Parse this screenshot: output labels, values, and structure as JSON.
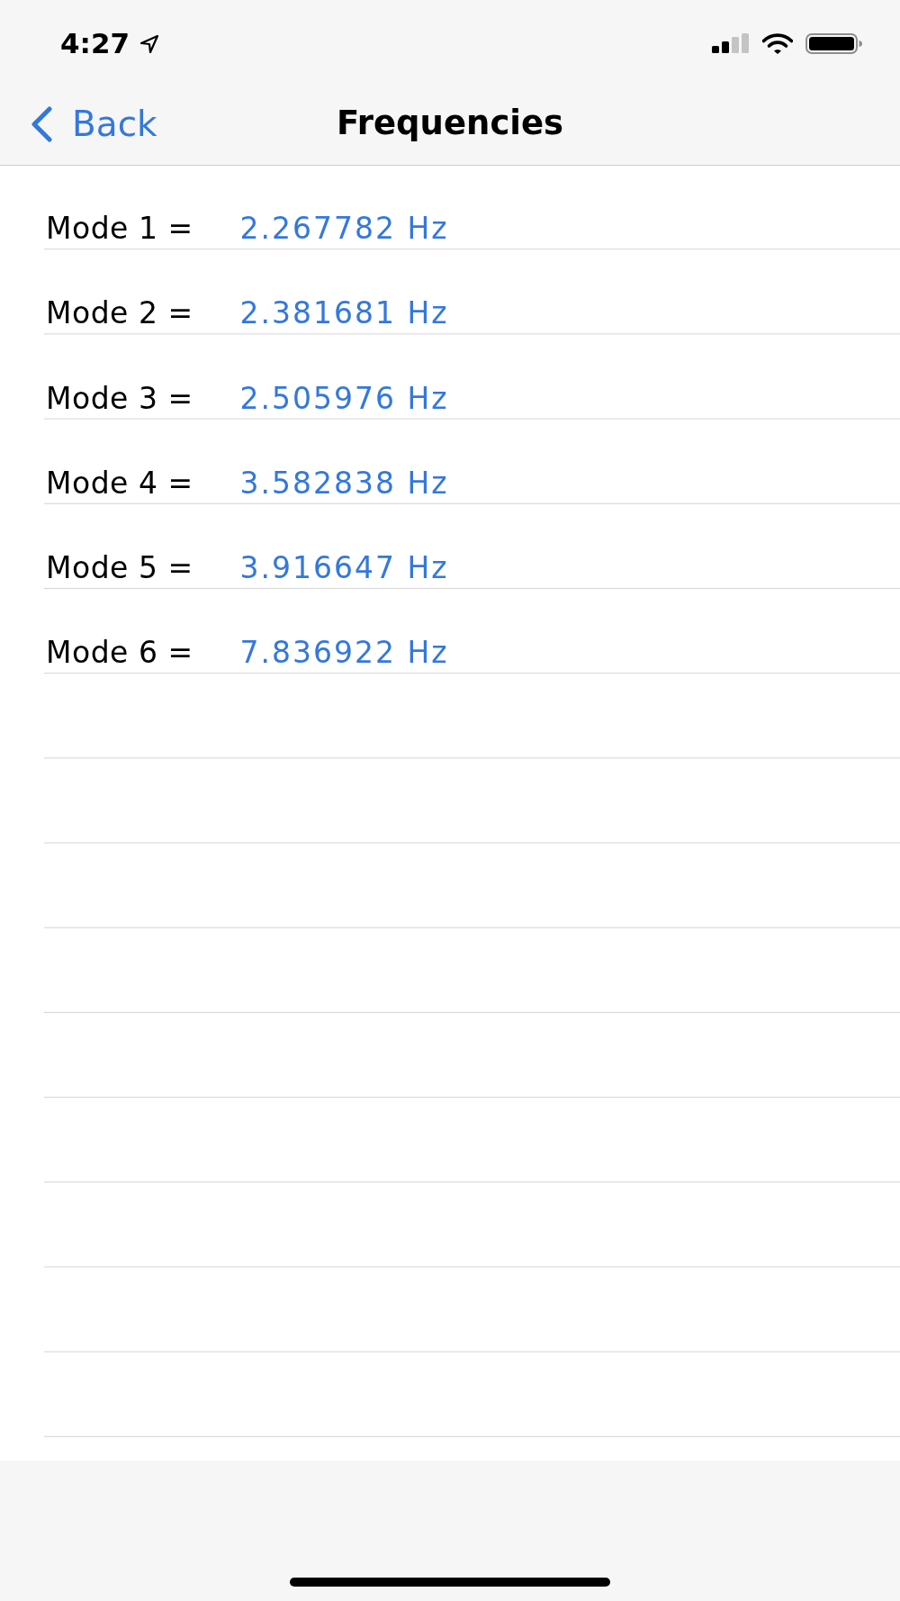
{
  "status_bar": {
    "time": "4:27"
  },
  "nav_bar": {
    "back_button": "Back",
    "title": "Frequencies"
  },
  "frequencies": [
    {
      "label": "Mode 1 =",
      "value": "2.267782 Hz"
    },
    {
      "label": "Mode 2 =",
      "value": "2.381681 Hz"
    },
    {
      "label": "Mode 3 =",
      "value": "2.505976 Hz"
    },
    {
      "label": "Mode 4 =",
      "value": "3.582838 Hz"
    },
    {
      "label": "Mode 5 =",
      "value": "3.916647 Hz"
    },
    {
      "label": "Mode 6 =",
      "value": "7.836922 Hz"
    }
  ]
}
